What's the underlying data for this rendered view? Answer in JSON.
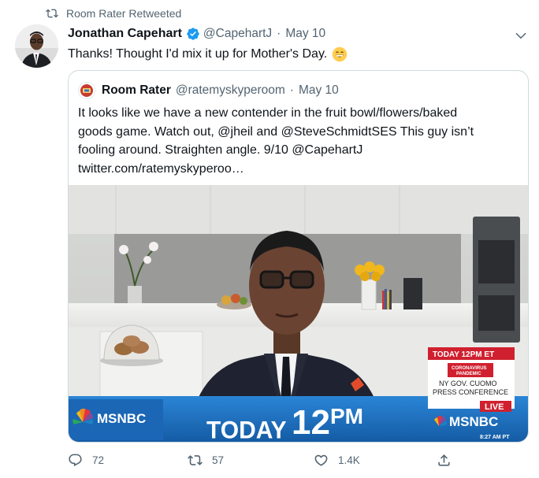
{
  "retweet": {
    "label": "Room Rater Retweeted"
  },
  "tweet": {
    "author_name": "Jonathan Capehart",
    "handle": "@CapehartJ",
    "separator": "·",
    "date": "May 10",
    "text": "Thanks! Thought I'd mix it up for Mother's Day.",
    "emoji": "grinning-face-emoji"
  },
  "quote": {
    "author_name": "Room Rater",
    "handle": "@ratemyskyperoom",
    "separator": "·",
    "date": "May 10",
    "text": "It looks like we have a new contender in the fruit bowl/flowers/baked\ngoods game. Watch out, @jheil and @SteveSchmidtSES This guy isn’t\nfooling around. Straighten angle.  9/10 @CapehartJ\ntwitter.com/ratemyskyperoo…"
  },
  "media": {
    "network_logo_left": "MSNBC",
    "banner_text": "TODAY",
    "banner_time": "12",
    "banner_pm": "PM",
    "box_header": "TODAY 12PM ET",
    "box_tag_1": "CORONAVIRUS",
    "box_tag_2": "PANDEMIC",
    "box_line_1": "NY GOV. CUOMO",
    "box_line_2": "PRESS CONFERENCE",
    "live": "LIVE",
    "network_logo_right": "MSNBC",
    "clock": "8:27 AM PT"
  },
  "actions": {
    "replies": "72",
    "retweets": "57",
    "likes": "1.4K"
  },
  "colors": {
    "verified": "#1d9bf0",
    "secondary_text": "#536471",
    "border": "#cfd9de",
    "msnbc_blue": "#1e6fc0",
    "live_red": "#d0202f"
  }
}
